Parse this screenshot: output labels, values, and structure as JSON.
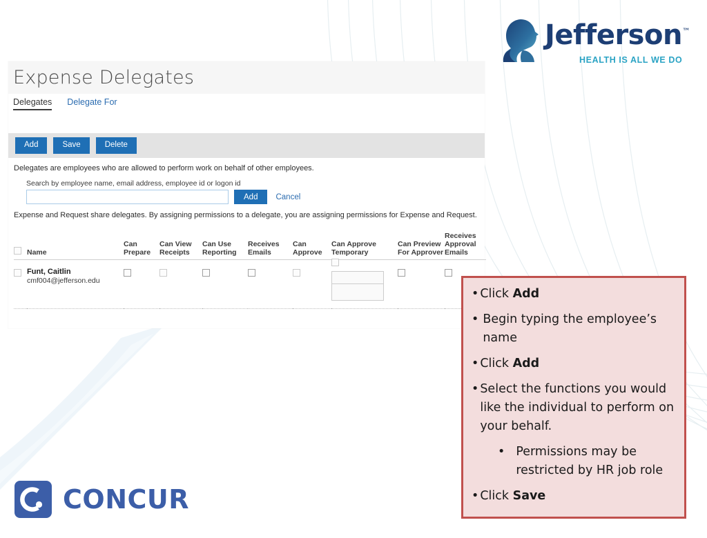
{
  "brand": {
    "jefferson": {
      "wordmark": "Jefferson",
      "trademark": "™",
      "tagline": "HEALTH IS ALL WE DO",
      "mark_color": "#1d3e74",
      "tagline_color": "#2aa3c4"
    },
    "concur": {
      "wordmark": "CONCUR",
      "mark_letter": "C",
      "color": "#3c5ea8"
    }
  },
  "app": {
    "page_title": "Expense Delegates",
    "tabs": [
      {
        "label": "Delegates",
        "active": true
      },
      {
        "label": "Delegate For",
        "active": false
      }
    ],
    "toolbar": {
      "add_label": "Add",
      "save_label": "Save",
      "delete_label": "Delete",
      "button_color": "#1f6fb5"
    },
    "info_text": "Delegates are employees who are allowed to perform work on behalf of other employees.",
    "search": {
      "label": "Search by employee name, email address, employee id or logon id",
      "value": "",
      "placeholder": "",
      "add_label": "Add",
      "cancel_label": "Cancel"
    },
    "share_note": "Expense and Request share delegates. By assigning permissions to a delegate, you are assigning permissions for Expense and Request.",
    "table": {
      "columns": [
        "Name",
        "Can Prepare",
        "Can View Receipts",
        "Can Use Reporting",
        "Receives Emails",
        "Can Approve",
        "Can Approve Temporary",
        "Can Preview For Approver",
        "Receives Approval Emails"
      ],
      "rows": [
        {
          "name": "Funt, Caitlin",
          "email": "cmf004@jefferson.edu",
          "can_prepare": false,
          "can_view_receipts": false,
          "can_use_reporting": false,
          "receives_emails": false,
          "can_approve": false,
          "can_approve_temporary": false,
          "temp_start": "",
          "temp_end": "",
          "can_preview_for_approver": false,
          "receives_approval_emails": false
        }
      ]
    }
  },
  "callout": {
    "border_color": "#c0504d",
    "fill_color": "#f3dddd",
    "items": [
      {
        "bullet": "•",
        "pre": "Click ",
        "strong": "Add",
        "post": "",
        "spaced": false,
        "sub": false
      },
      {
        "bullet": "•",
        "pre": "Begin typing the employee’s name",
        "strong": "",
        "post": "",
        "spaced": true,
        "sub": false
      },
      {
        "bullet": "•",
        "pre": "Click ",
        "strong": "Add",
        "post": "",
        "spaced": false,
        "sub": false
      },
      {
        "bullet": "•",
        "pre": "Select the functions you would like the individual to perform on your behalf.",
        "strong": "",
        "post": "",
        "spaced": false,
        "sub": false
      },
      {
        "bullet": "•",
        "pre": "Permissions may be restricted by HR job role",
        "strong": "",
        "post": "",
        "spaced": false,
        "sub": true
      },
      {
        "bullet": "•",
        "pre": "Click ",
        "strong": "Save",
        "post": "",
        "spaced": false,
        "sub": false
      }
    ]
  }
}
